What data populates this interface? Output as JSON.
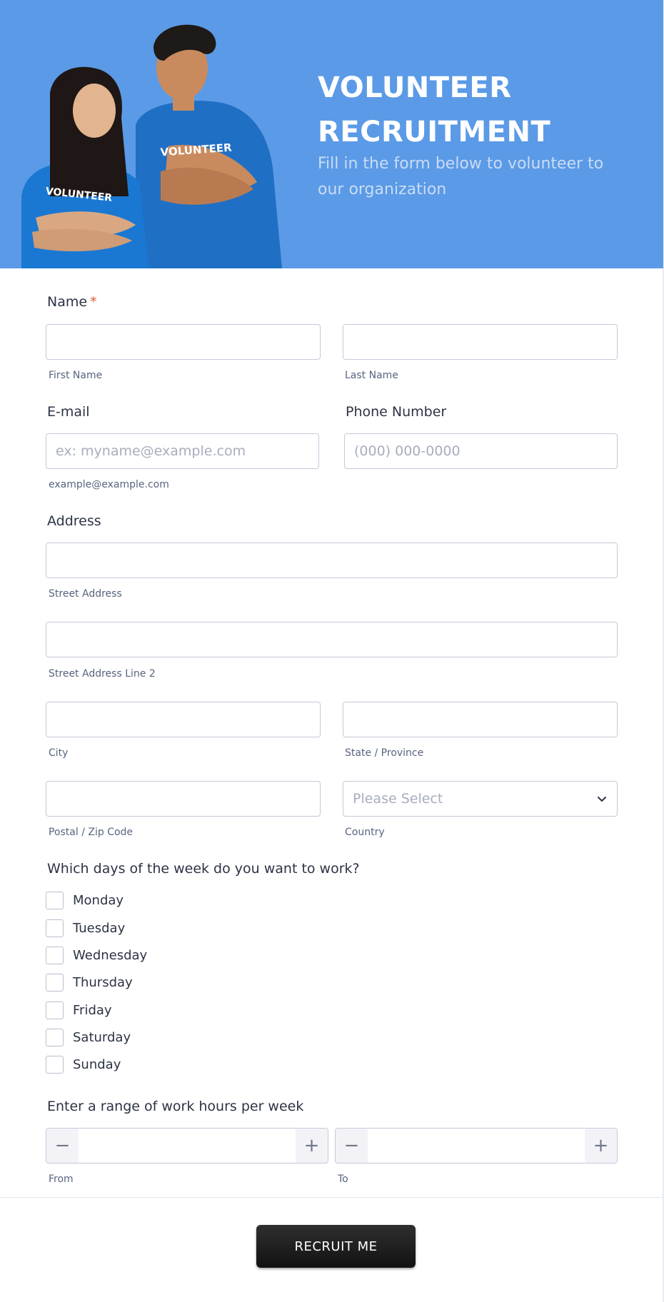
{
  "header": {
    "title_line1": "VOLUNTEER",
    "title_line2": "RECRUITMENT",
    "subtitle": "Fill in the form below to volunteer to our organization",
    "shirt_text": "VOLUNTEER",
    "background_color": "#5b9ae6"
  },
  "name": {
    "label": "Name",
    "required_mark": "*",
    "first_sublabel": "First Name",
    "last_sublabel": "Last Name"
  },
  "email": {
    "label": "E-mail",
    "placeholder": "ex: myname@example.com",
    "sublabel": "example@example.com"
  },
  "phone": {
    "label": "Phone Number",
    "placeholder": "(000) 000-0000"
  },
  "address": {
    "label": "Address",
    "street_sublabel": "Street Address",
    "street2_sublabel": "Street Address Line 2",
    "city_sublabel": "City",
    "state_sublabel": "State / Province",
    "zip_sublabel": "Postal / Zip Code",
    "country_placeholder": "Please Select",
    "country_sublabel": "Country"
  },
  "days": {
    "question": "Which days of the week do you want to work?",
    "options": [
      "Monday",
      "Tuesday",
      "Wednesday",
      "Thursday",
      "Friday",
      "Saturday",
      "Sunday"
    ]
  },
  "hours": {
    "question": "Enter a range of work hours per week",
    "minus": "−",
    "plus": "+",
    "from_sublabel": "From",
    "to_sublabel": "To"
  },
  "submit": {
    "label": "RECRUIT ME"
  }
}
